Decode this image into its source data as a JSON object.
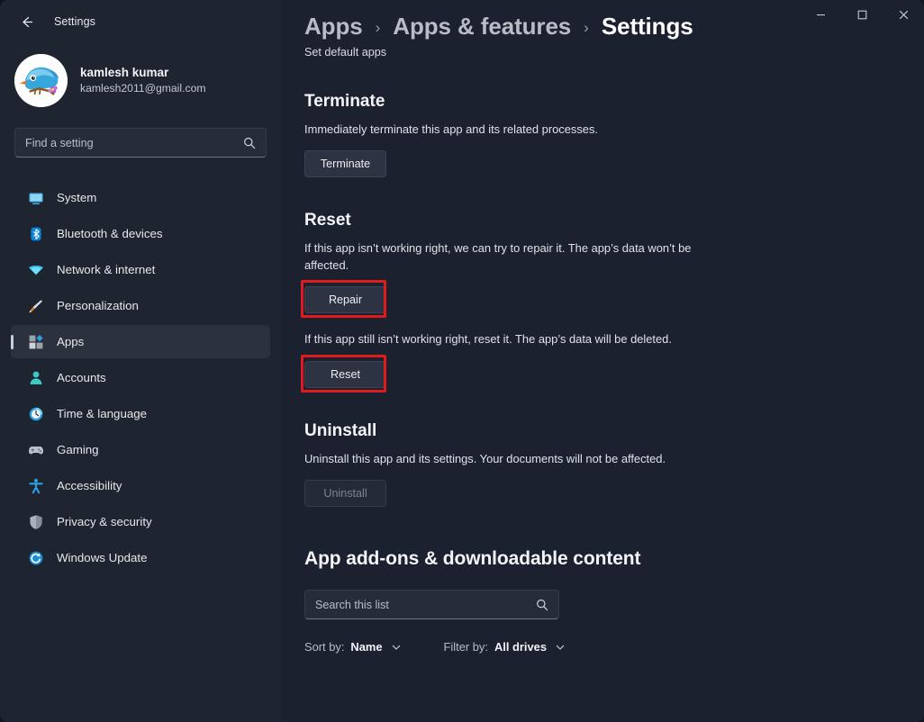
{
  "window": {
    "app_title": "Settings",
    "back_icon": "back-arrow-icon",
    "controls": {
      "minimize": "minimize-icon",
      "maximize": "maximize-icon",
      "close": "close-icon"
    }
  },
  "account": {
    "name": "kamlesh kumar",
    "email": "kamlesh2011@gmail.com",
    "avatar_icon": "bird-avatar"
  },
  "search": {
    "placeholder": "Find a setting",
    "value": "",
    "icon": "search-icon"
  },
  "sidebar": {
    "items": [
      {
        "label": "System",
        "icon": "monitor-icon",
        "selected": false
      },
      {
        "label": "Bluetooth & devices",
        "icon": "bluetooth-icon",
        "selected": false
      },
      {
        "label": "Network & internet",
        "icon": "wifi-icon",
        "selected": false
      },
      {
        "label": "Personalization",
        "icon": "paintbrush-icon",
        "selected": false
      },
      {
        "label": "Apps",
        "icon": "apps-grid-icon",
        "selected": true
      },
      {
        "label": "Accounts",
        "icon": "person-icon",
        "selected": false
      },
      {
        "label": "Time & language",
        "icon": "clock-icon",
        "selected": false
      },
      {
        "label": "Gaming",
        "icon": "gamepad-icon",
        "selected": false
      },
      {
        "label": "Accessibility",
        "icon": "accessibility-icon",
        "selected": false
      },
      {
        "label": "Privacy & security",
        "icon": "shield-icon",
        "selected": false
      },
      {
        "label": "Windows Update",
        "icon": "update-refresh-icon",
        "selected": false
      }
    ]
  },
  "breadcrumb": {
    "items": [
      "Apps",
      "Apps & features",
      "Settings"
    ],
    "separator": "›"
  },
  "page": {
    "subtitle": "Set default apps"
  },
  "sections": {
    "terminate": {
      "title": "Terminate",
      "description": "Immediately terminate this app and its related processes.",
      "button": "Terminate"
    },
    "reset": {
      "title": "Reset",
      "repair_description": "If this app isn’t working right, we can try to repair it. The app’s data won’t be affected.",
      "repair_button": "Repair",
      "reset_description": "If this app still isn’t working right, reset it. The app’s data will be deleted.",
      "reset_button": "Reset"
    },
    "uninstall": {
      "title": "Uninstall",
      "description": "Uninstall this app and its settings. Your documents will not be affected.",
      "button": "Uninstall",
      "button_disabled": true
    },
    "addons": {
      "title": "App add-ons & downloadable content",
      "search_placeholder": "Search this list",
      "search_value": "",
      "search_icon": "search-icon",
      "sort_label": "Sort by:",
      "sort_value": "Name",
      "filter_label": "Filter by:",
      "filter_value": "All drives",
      "chevron_icon": "chevron-down-icon"
    }
  },
  "annotations": {
    "highlight_color": "#e01b1b",
    "highlighted": [
      "Repair",
      "Reset"
    ]
  }
}
